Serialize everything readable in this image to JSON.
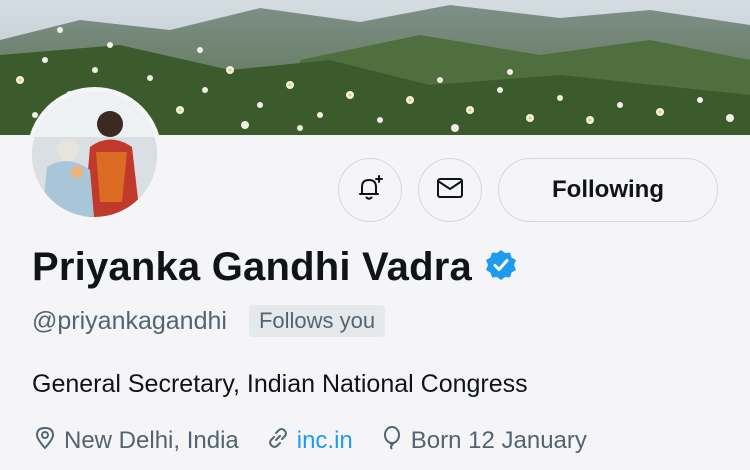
{
  "profile": {
    "name": "Priyanka Gandhi Vadra",
    "handle": "@priyankagandhi",
    "follows_you": "Follows you",
    "bio": "General Secretary, Indian National Congress",
    "verified": true
  },
  "actions": {
    "notify_icon": "bell-plus-icon",
    "message_icon": "envelope-icon",
    "follow_label": "Following"
  },
  "meta": {
    "location": "New Delhi, India",
    "website": "inc.in",
    "birthday": "Born 12 January"
  },
  "colors": {
    "accent": "#1d9bf0",
    "muted_text": "#536471",
    "primary_text": "#0f1419"
  }
}
